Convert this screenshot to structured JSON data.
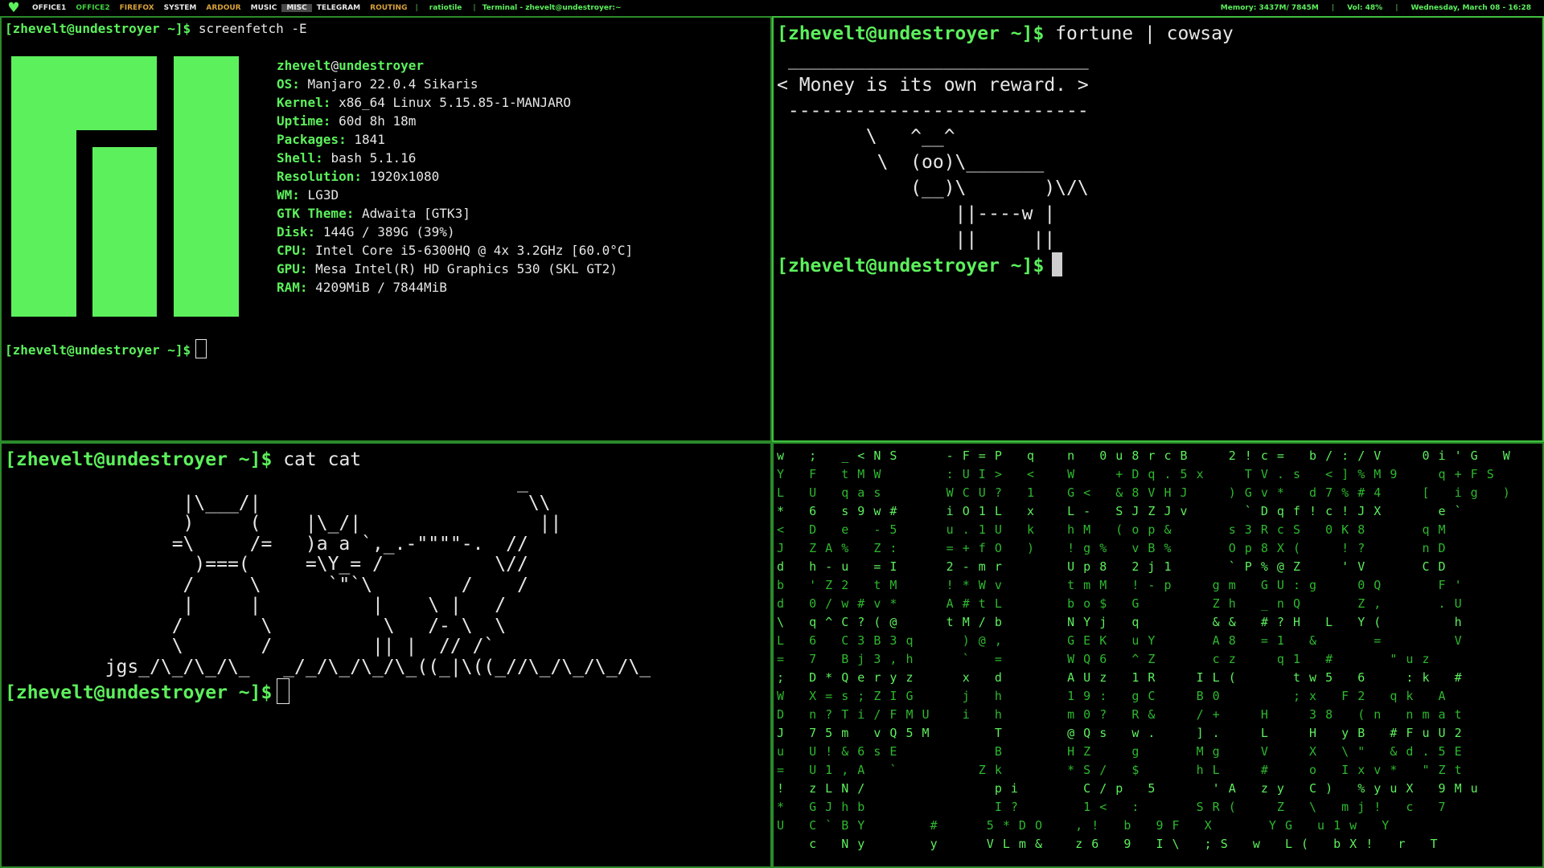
{
  "topbar": {
    "workspaces": [
      {
        "label": "OFFICE1",
        "style": "white"
      },
      {
        "label": "OFFICE2",
        "style": "green"
      },
      {
        "label": "FIREFOX",
        "style": "orange"
      },
      {
        "label": "SYSTEM",
        "style": "white"
      },
      {
        "label": "ARDOUR",
        "style": "orange"
      },
      {
        "label": "MUSIC",
        "style": "white"
      },
      {
        "label": "MISC",
        "style": "active"
      },
      {
        "label": "TELEGRAM",
        "style": "white"
      },
      {
        "label": "ROUTING",
        "style": "orange"
      }
    ],
    "layout": "ratiotile",
    "window_title": "Terminal - zhevelt@undestroyer:~",
    "memory": "Memory:  3437M/ 7845M",
    "volume": "Vol: 48%",
    "datetime": "Wednesday, March 08 - 16:28",
    "colors": {
      "accent": "#5cf05c",
      "orange": "#d8a23a"
    }
  },
  "pane_tl": {
    "prompt": "[zhevelt@undestroyer ~]$",
    "command": "screenfetch -E",
    "user": "zhevelt",
    "at": "@",
    "host": "undestroyer",
    "info": [
      {
        "label": "OS:",
        "value": "Manjaro 22.0.4 Sikaris"
      },
      {
        "label": "Kernel:",
        "value": "x86_64 Linux 5.15.85-1-MANJARO"
      },
      {
        "label": "Uptime:",
        "value": "60d 8h 18m"
      },
      {
        "label": "Packages:",
        "value": "1841"
      },
      {
        "label": "Shell:",
        "value": "bash 5.1.16"
      },
      {
        "label": "Resolution:",
        "value": "1920x1080"
      },
      {
        "label": "WM:",
        "value": "LG3D"
      },
      {
        "label": "GTK Theme:",
        "value": "Adwaita [GTK3]"
      },
      {
        "label": "Disk:",
        "value": "144G / 389G (39%)"
      },
      {
        "label": "CPU:",
        "value": "Intel Core i5-6300HQ @ 4x 3.2GHz [60.0°C]"
      },
      {
        "label": "GPU:",
        "value": "Mesa Intel(R) HD Graphics 530 (SKL GT2)"
      },
      {
        "label": "RAM:",
        "value": "4209MiB / 7844MiB"
      }
    ],
    "prompt2": "[zhevelt@undestroyer ~]$"
  },
  "pane_tr": {
    "prompt": "[zhevelt@undestroyer ~]$",
    "command": "fortune | cowsay",
    "cowsay": " ___________________________\n< Money is its own reward. >\n ---------------------------\n        \\   ^__^\n         \\  (oo)\\_______\n            (__)\\       )\\/\\\n                ||----w |\n                ||     ||",
    "prompt2": "[zhevelt@undestroyer ~]$"
  },
  "pane_bl": {
    "prompt": "[zhevelt@undestroyer ~]$",
    "command": "cat cat",
    "art": "                                              _\n                |\\___/|                        \\\\\n                )     (    |\\_/|                ||\n               =\\     /=   )a a `,_.-\"\"\"\"-.  //\n                 )===(     =\\Y_= /          \\//\n                /     \\      `\"`\\        /    /\n                |     |          |    \\ |   /\n               /       \\          \\   /- \\  \\\n               \\       /         || |  // /`\n         jgs_/\\_/\\_/\\_   _/_/\\_/\\_/\\_((_|\\((_//\\_/\\_/\\_/\\_",
    "prompt2": "[zhevelt@undestroyer ~]$"
  },
  "pane_br": {
    "matrix_lines": [
      "w   ;   _ < N S      - F = P   q    n   0 u 8 r c B     2 ! c =   b / : / V     0 i ' G   W",
      "Y   F   t M W        : U I >   <    W     + D q . 5 x     T V . s   < ] % M 9     q + F S",
      "L   U   q a s        W C U ?   1    G <   & 8 V H J     ) G v *   d 7 % # 4     [   i g   )",
      "*   6   s 9 w #      i O 1 L   x    L -   S J Z J v       ` D q f ! c ! J X       e `",
      "<   D   e   - 5      u . 1 U   k    h M   ( o p &       s 3 R c S   0 K 8       q M",
      "J   Z A %   Z :      = + f O   )    ! g %   v B %       O p 8 X (     ! ?       n D",
      "d   h - u   = I      2 - m r        U p 8   2 j 1       ` P % @ Z     ' V       C D",
      "b   ' Z 2   t M      ! * W v        t m M   ! - p     g m   G U : g     0 Q       F '",
      "d   0 / w # v *      A # t L        b o $   G         Z h   _ n Q       Z ,       . U",
      "\\   q ^ C ? ( @      t M / b        N Y j   q         & &   # ? H   L   Y (         h",
      "L   6   C 3 B 3 q      ) @ ,        G E K   u Y       A 8   = 1   &       =         V",
      "=   7   B j 3 , h      `   =        W Q 6   ^ Z       c z     q 1   #       \" u z",
      ";   D * Q e r y z      x   d        A U z   1 R     I L (       t w 5   6     : k   #",
      "W   X = s ; Z I G      j   h        1 9 :   g C     B 0         ; x   F 2   q k   A",
      "D   n ? T i / F M U    i   h        m 0 ?   R &     / +     H     3 8   ( n   n m a t",
      "J   7 5 m   v Q 5 M        T        @ Q s   w .     ] .     L     H   y B   # F u U 2",
      "u   U ! & 6 s E            B        H Z     g       M g     V     X   \\ \"   & d . 5 E",
      "=   U 1 , A   `          Z k        * S /   $       h L     #     o   I x v *   \" Z t",
      "!   z L N /                p i        C / p   5       ' A   z y   C )   % y u X   9 M u",
      "*   G J h b                I ?        1 <   :       S R (     Z   \\   m j !   c   7",
      "U   C ` B Y        #      5 * D O    , !   b   9 F   X       Y G   u 1 w   Y",
      "    c   N y        y      V L m &    z 6   9   I \\   ; S   w   L (   b X !   r   T"
    ]
  }
}
